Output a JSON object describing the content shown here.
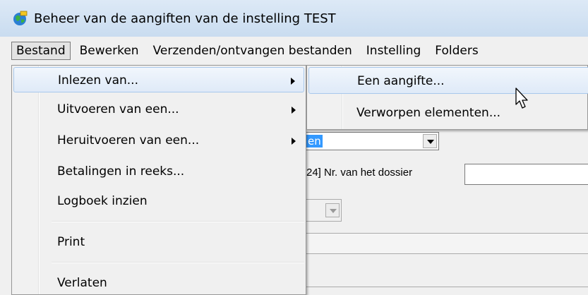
{
  "window": {
    "title": "Beheer van de aangiften van de instelling TEST",
    "icon": "app-globe-icon"
  },
  "menubar": {
    "items": [
      {
        "label": "Bestand",
        "active": true
      },
      {
        "label": "Bewerken"
      },
      {
        "label": "Verzenden/ontvangen bestanden"
      },
      {
        "label": "Instelling"
      },
      {
        "label": "Folders"
      }
    ]
  },
  "file_menu": {
    "items": [
      {
        "label": "Inlezen van...",
        "submenu": true,
        "highlighted": true
      },
      {
        "label": "Uitvoeren van een...",
        "submenu": true
      },
      {
        "label": "Heruitvoeren van een...",
        "submenu": true
      },
      {
        "label": "Betalingen in reeks..."
      },
      {
        "label": "Logboek inzien"
      },
      {
        "label": "Print"
      },
      {
        "label": "Verlaten"
      }
    ]
  },
  "submenu": {
    "items": [
      {
        "label": "Een aangifte...",
        "highlighted": true
      },
      {
        "label": "Verworpen elementen..."
      }
    ]
  },
  "form": {
    "combo1_value": "en",
    "dossier_label": "24] Nr. van het dossier"
  },
  "colors": {
    "highlight": "#dfeaf8",
    "selection": "#3399ff",
    "titlebar": "#c9dcf0"
  }
}
